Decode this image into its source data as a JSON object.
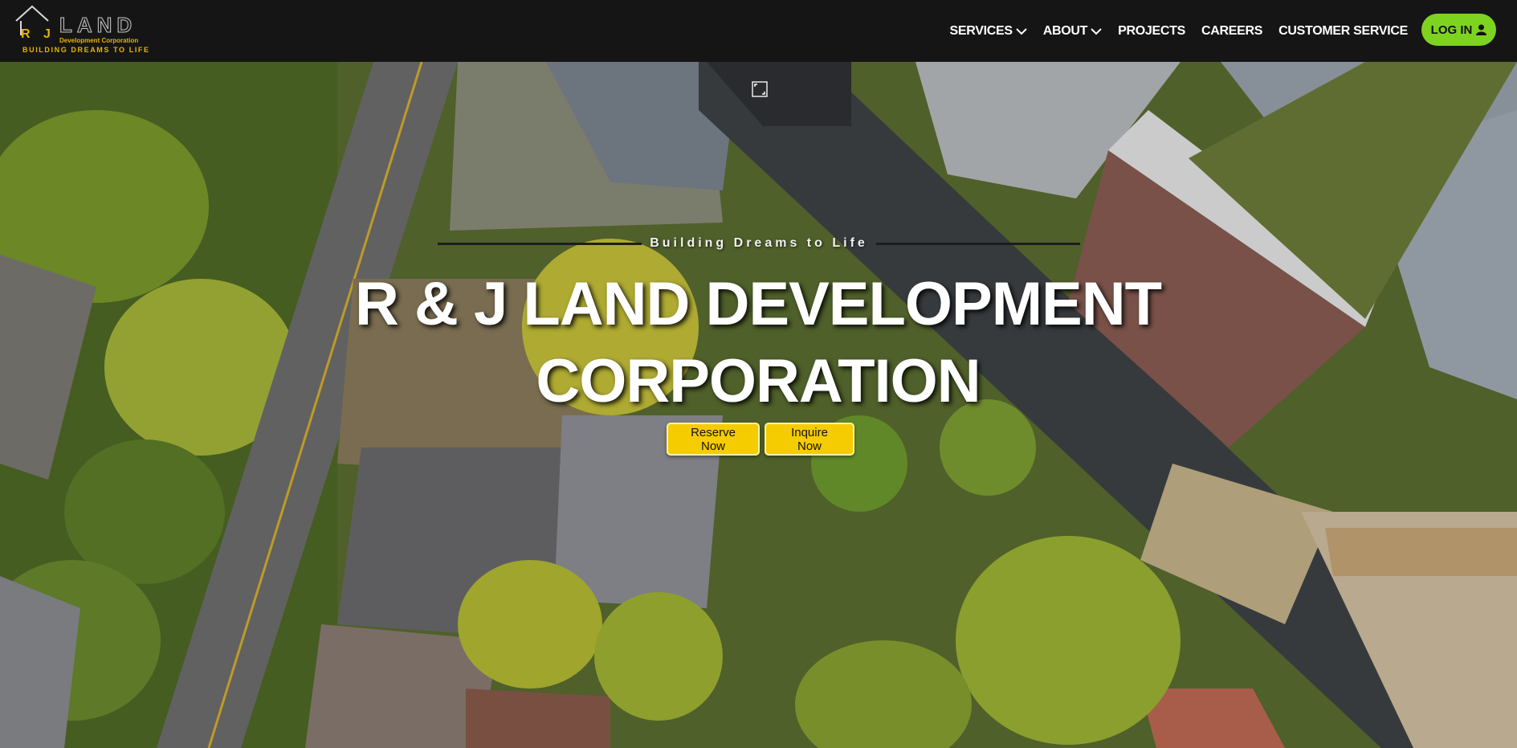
{
  "brand": {
    "logo_initials": "R J",
    "logo_word": "LAND",
    "logo_subtitle": "Development Corporation",
    "logo_tagline": "BUILDING DREAMS TO LIFE",
    "accent_color": "#e6b400"
  },
  "nav": {
    "items": [
      {
        "label": "SERVICES",
        "has_dropdown": true
      },
      {
        "label": "ABOUT",
        "has_dropdown": true
      },
      {
        "label": "PROJECTS",
        "has_dropdown": false
      },
      {
        "label": "CAREERS",
        "has_dropdown": false
      },
      {
        "label": "CUSTOMER SERVICE",
        "has_dropdown": false
      }
    ],
    "login_label": "LOG IN",
    "login_icon": "user-icon",
    "login_color": "#7ed321"
  },
  "hero": {
    "tagline": "Building Dreams to Life",
    "title_line1": "R & J LAND DEVELOPMENT",
    "title_line2": "CORPORATION",
    "buttons": {
      "reserve_label": "Reserve Now",
      "inquire_label": "Inquire Now",
      "button_color": "#f5cc00"
    },
    "background": "aerial-neighborhood-photo",
    "media_icon": "expand-icon"
  }
}
